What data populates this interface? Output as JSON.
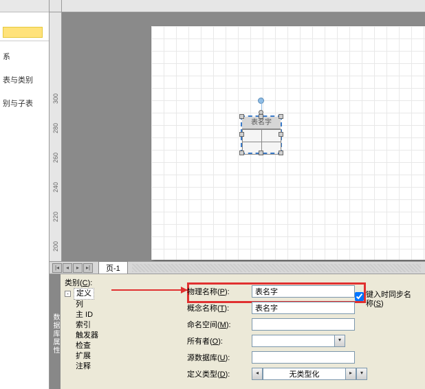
{
  "left_nav": {
    "items": [
      "系",
      "表与类别",
      "别与子表"
    ]
  },
  "ruler_v_ticks": [
    "200",
    "220",
    "240",
    "260",
    "280",
    "300"
  ],
  "canvas_entity": {
    "title": "表名字"
  },
  "page_tab": "页-1",
  "prop": {
    "vtab": "数据库属性",
    "category_label": "类别",
    "category_accel": "C",
    "tree_root": "定义",
    "tree_children": [
      "列",
      "主 ID",
      "索引",
      "触发器",
      "检查",
      "扩展",
      "注释"
    ],
    "rows": {
      "physical_name": {
        "label": "物理名称",
        "accel": "P",
        "value": "表名字"
      },
      "concept_name": {
        "label": "概念名称",
        "accel": "T",
        "value": "表名字"
      },
      "namespace": {
        "label": "命名空间",
        "accel": "M",
        "value": ""
      },
      "owner": {
        "label": "所有者",
        "accel": "O",
        "value": ""
      },
      "source_db": {
        "label": "源数据库",
        "accel": "U",
        "value": ""
      },
      "def_type": {
        "label": "定义类型",
        "accel": "D",
        "value": "无类型化"
      }
    },
    "sync_checkbox": {
      "label": "键入时同步名称",
      "accel": "S",
      "checked": true
    }
  }
}
